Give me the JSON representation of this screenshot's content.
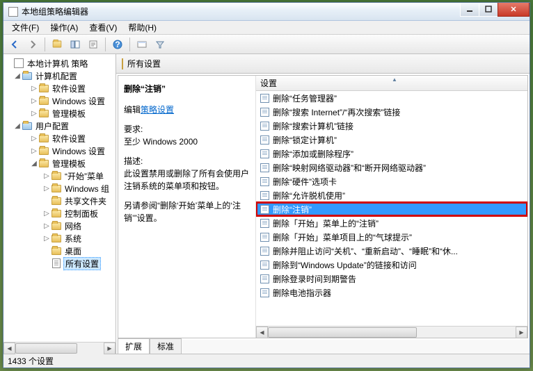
{
  "window": {
    "title": "本地组策略编辑器"
  },
  "menu": {
    "file": "文件(F)",
    "action": "操作(A)",
    "view": "查看(V)",
    "help": "帮助(H)"
  },
  "tree": {
    "root": "本地计算机 策略",
    "computer": "计算机配置",
    "c_software": "软件设置",
    "c_windows": "Windows 设置",
    "c_admin": "管理模板",
    "user": "用户配置",
    "u_software": "软件设置",
    "u_windows": "Windows 设置",
    "u_admin": "管理模板",
    "start_menu": "“开始”菜单",
    "windows_comp": "Windows 组",
    "shared": "共享文件夹",
    "control_panel": "控制面板",
    "network": "网络",
    "system": "系统",
    "desktop": "桌面",
    "all_settings": "所有设置"
  },
  "header": {
    "title": "所有设置"
  },
  "detail": {
    "title": "删除“注销”",
    "edit_prefix": "编辑",
    "edit_link": "策略设置",
    "req_label": "要求:",
    "req_value": "至少 Windows 2000",
    "desc_label": "描述:",
    "desc1": "此设置禁用或删除了所有会使用户注销系统的菜单项和按钮。",
    "desc2": "另请参阅“删除‘开始’菜单上的‘注销’”设置。"
  },
  "list": {
    "header": "设置",
    "items": [
      "删除“任务管理器”",
      "删除“搜索 Internet”/“再次搜索”链接",
      "删除“搜索计算机”链接",
      "删除“锁定计算机”",
      "删除“添加或删除程序”",
      "删除“映射网络驱动器”和“断开网络驱动器”",
      "删除“硬件”选项卡",
      "删除“允许脱机使用”",
      "删除“注销”",
      "删除「开始」菜单上的“注销”",
      "删除「开始」菜单项目上的“气球提示”",
      "删除并阻止访问“关机”、“重新启动”、“睡眠”和“休...",
      "删除到“Windows Update”的链接和访问",
      "删除登录时间到期警告",
      "删除电池指示器"
    ],
    "selected_index": 8
  },
  "tabs": {
    "extended": "扩展",
    "standard": "标准"
  },
  "status": {
    "text": "1433 个设置"
  }
}
